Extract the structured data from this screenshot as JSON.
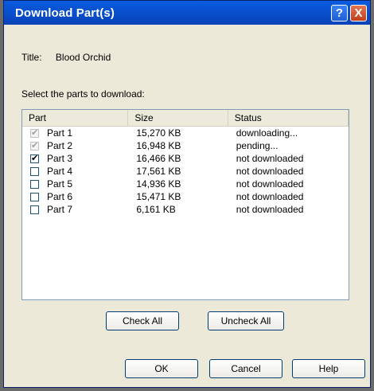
{
  "window": {
    "title": "Download Part(s)",
    "help_btn": "?",
    "close_btn": "X"
  },
  "info": {
    "title_label": "Title:",
    "title_value": "Blood Orchid",
    "prompt": "Select the parts to download:"
  },
  "table": {
    "headers": [
      "Part",
      "Size",
      "Status"
    ],
    "rows": [
      {
        "part": "Part 1",
        "size": "15,270 KB",
        "status": "downloading...",
        "checked": true,
        "disabled": true
      },
      {
        "part": "Part 2",
        "size": "16,948 KB",
        "status": "pending...",
        "checked": true,
        "disabled": true
      },
      {
        "part": "Part 3",
        "size": "16,466 KB",
        "status": "not downloaded",
        "checked": true,
        "disabled": false
      },
      {
        "part": "Part 4",
        "size": "17,561 KB",
        "status": "not downloaded",
        "checked": false,
        "disabled": false
      },
      {
        "part": "Part 5",
        "size": "14,936 KB",
        "status": "not downloaded",
        "checked": false,
        "disabled": false
      },
      {
        "part": "Part 6",
        "size": "15,471 KB",
        "status": "not downloaded",
        "checked": false,
        "disabled": false
      },
      {
        "part": "Part 7",
        "size": "6,161 KB",
        "status": "not downloaded",
        "checked": false,
        "disabled": false
      }
    ]
  },
  "buttons": {
    "check_all": "Check All",
    "uncheck_all": "Uncheck All",
    "ok": "OK",
    "cancel": "Cancel",
    "help": "Help"
  }
}
